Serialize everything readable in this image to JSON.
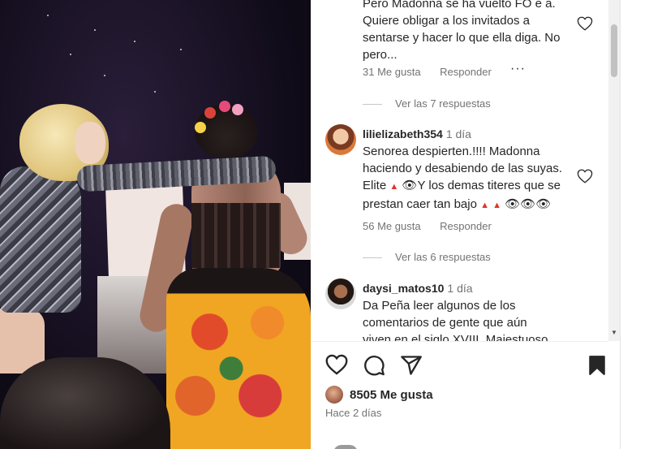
{
  "comments": [
    {
      "text_lines": [
        "Pero Madonna se ha vuelto FO e a.",
        "Quiere obligar a los invitados a",
        "sentarse y hacer lo que ella diga. No",
        "pero..."
      ],
      "likes": "31 Me gusta",
      "reply": "Responder",
      "more": "···",
      "view_replies": "Ver las 7 respuestas"
    },
    {
      "username": "lilielizabeth354",
      "age": "1 día",
      "text_lines": [
        "Senorea despierten.!!!! Madonna",
        "haciendo y desabiendo de las suyas.",
        "Elite",
        "Y los demas titeres que se",
        "prestan caer tan bajo"
      ],
      "emoji": {
        "triangle": "▲",
        "eye": "👁"
      },
      "likes": "56 Me gusta",
      "reply": "Responder",
      "view_replies": "Ver las 6 respuestas"
    },
    {
      "username": "daysi_matos10",
      "age": "1 día",
      "text_lines": [
        "Da Peña leer algunos de los",
        "comentarios de gente que aún",
        "viven en el siglo XVIII. Majestuoso"
      ]
    }
  ],
  "post": {
    "likes_count": "8505 Me gusta",
    "posted": "Hace 2 días"
  },
  "icons": [
    "heart-icon",
    "comment-icon",
    "share-icon",
    "bookmark-icon",
    "more-icon"
  ],
  "colors": {
    "text": "#262626",
    "muted": "#737373",
    "heart_outline": "#262626"
  }
}
